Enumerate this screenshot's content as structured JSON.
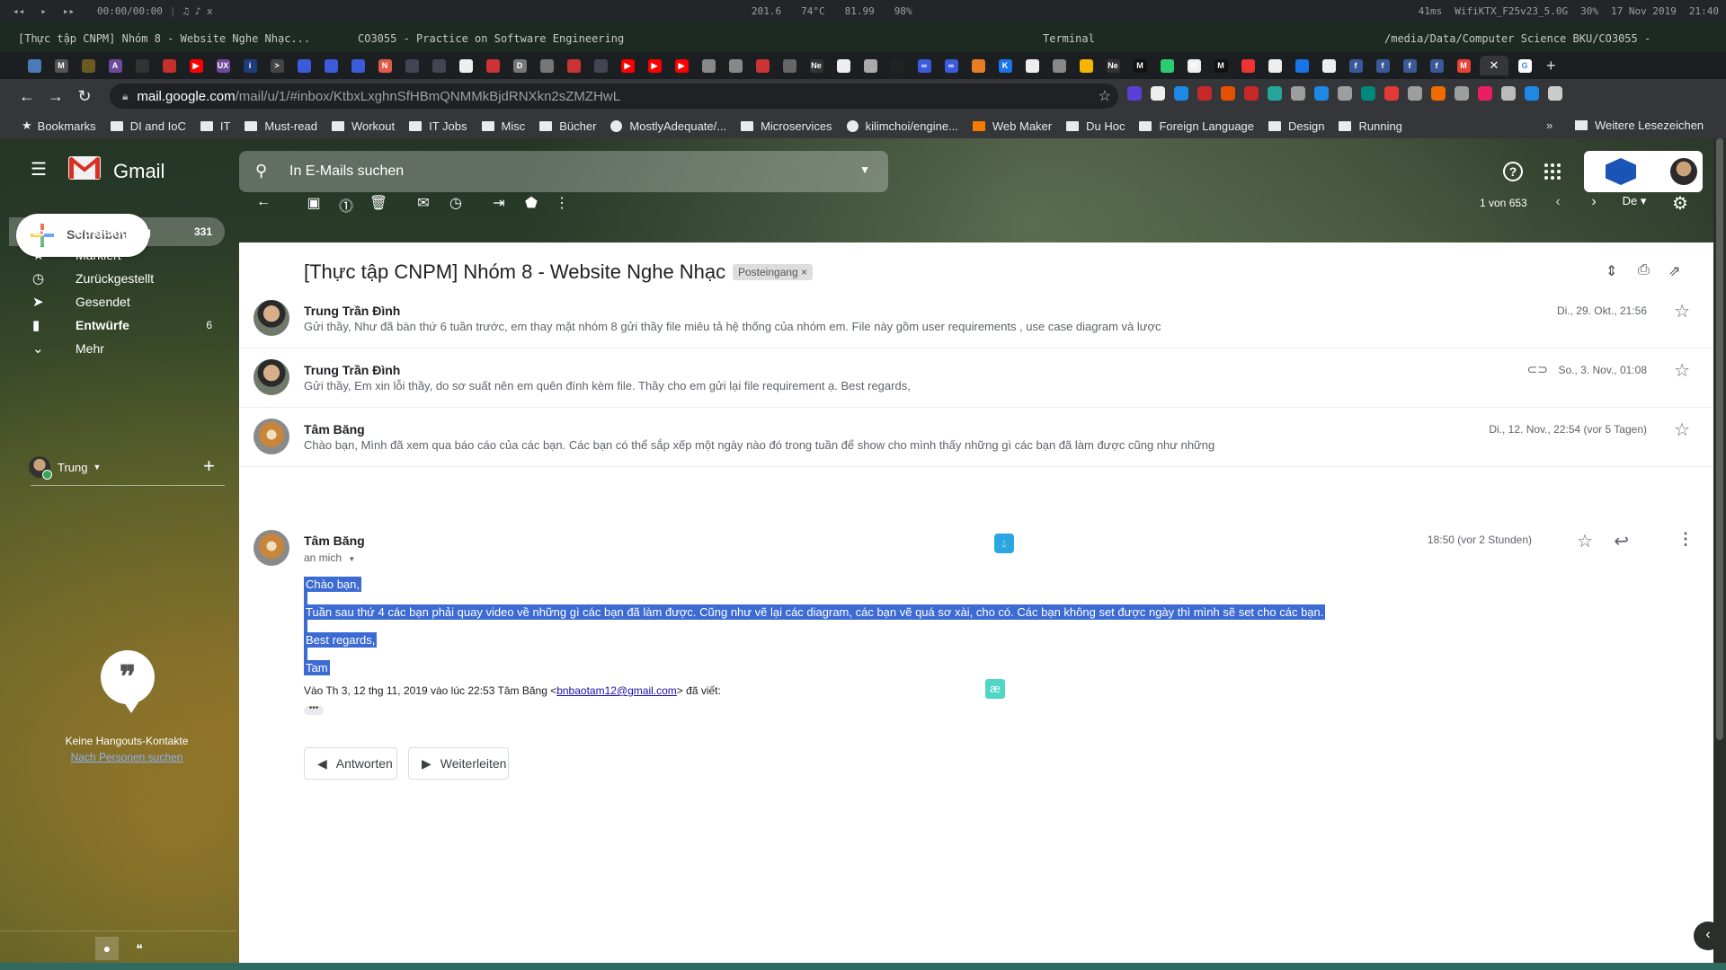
{
  "system_bar": {
    "media_prev": "◂◂",
    "media_play": "▸",
    "media_next": "▸▸",
    "time_display": "00:00/00:00",
    "music_status": "♫ ♪ x",
    "cpu_temp": "74°C",
    "cpu_value": "201.6",
    "mem_value": "81.99",
    "battery": "98%",
    "ping": "41ms",
    "wifi": "WifiKTX_F25v23_5.0G",
    "volume": "30%",
    "date": "17 Nov 2019",
    "clock": "21:40"
  },
  "window_titles": {
    "active": "[Thực tập CNPM] Nhóm 8 - Website Nghe Nhạc...",
    "second": "CO3055 -  Practice on Software Engineering",
    "terminal": "Terminal",
    "path": "/media/Data/Computer Science BKU/CO3055 -"
  },
  "browser": {
    "url_host": "mail.google.com",
    "url_path": "/mail/u/1/#inbox/KtbxLxghnSfHBmQNMMkBjdRNXkn2sZMZHwL",
    "tab_icons": [
      {
        "letter": "",
        "color": "#4a7ab8"
      },
      {
        "letter": "M",
        "color": "#555"
      },
      {
        "letter": "",
        "color": "#6b5a22"
      },
      {
        "letter": "A",
        "color": "#6d4a9b"
      },
      {
        "letter": "",
        "color": "#333"
      },
      {
        "letter": "",
        "color": "#c4302b"
      },
      {
        "letter": "▶",
        "color": "#ff0000"
      },
      {
        "letter": "UX",
        "color": "#6d4a9b"
      },
      {
        "letter": "i",
        "color": "#1f3c7a"
      },
      {
        "letter": ">",
        "color": "#444"
      },
      {
        "letter": "",
        "color": "#3b5bdb"
      },
      {
        "letter": "",
        "color": "#3b5bdb"
      },
      {
        "letter": "",
        "color": "#3b5bdb"
      },
      {
        "letter": "N",
        "color": "#e05a47"
      },
      {
        "letter": "",
        "color": "#445"
      },
      {
        "letter": "",
        "color": "#445"
      },
      {
        "letter": "",
        "color": "#eee"
      },
      {
        "letter": "",
        "color": "#c33"
      },
      {
        "letter": "D",
        "color": "#777"
      },
      {
        "letter": "",
        "color": "#777"
      },
      {
        "letter": "",
        "color": "#c33"
      },
      {
        "letter": "",
        "color": "#445"
      },
      {
        "letter": "▶",
        "color": "#ff0000"
      },
      {
        "letter": "▶",
        "color": "#ff0000"
      },
      {
        "letter": "▶",
        "color": "#ff0000"
      },
      {
        "letter": "",
        "color": "#888"
      },
      {
        "letter": "",
        "color": "#888"
      },
      {
        "letter": "",
        "color": "#c33"
      },
      {
        "letter": "",
        "color": "#666"
      },
      {
        "letter": "Ne",
        "color": "#333"
      },
      {
        "letter": "",
        "color": "#eee"
      },
      {
        "letter": "",
        "color": "#aaa"
      },
      {
        "letter": "",
        "color": "#222"
      },
      {
        "letter": "∞",
        "color": "#3b5bdb"
      },
      {
        "letter": "∞",
        "color": "#3b5bdb"
      },
      {
        "letter": "",
        "color": "#e67e22"
      },
      {
        "letter": "K",
        "color": "#1a73e8"
      },
      {
        "letter": "",
        "color": "#eee"
      },
      {
        "letter": "",
        "color": "#888"
      },
      {
        "letter": "",
        "color": "#f4b400"
      },
      {
        "letter": "Ne",
        "color": "#333"
      },
      {
        "letter": "M",
        "color": "#111"
      },
      {
        "letter": "",
        "color": "#2ecc71"
      },
      {
        "letter": "W",
        "color": "#eee"
      },
      {
        "letter": "M",
        "color": "#111"
      },
      {
        "letter": "",
        "color": "#e33"
      },
      {
        "letter": "",
        "color": "#eee"
      },
      {
        "letter": "",
        "color": "#1a73e8"
      },
      {
        "letter": "",
        "color": "#eee"
      },
      {
        "letter": "f",
        "color": "#3b5998"
      },
      {
        "letter": "f",
        "color": "#3b5998"
      },
      {
        "letter": "f",
        "color": "#3b5998"
      },
      {
        "letter": "f",
        "color": "#3b5998"
      },
      {
        "letter": "M",
        "color": "#ea4335"
      }
    ],
    "active_tab_close": "✕",
    "after_active": {
      "letter": "G",
      "color": "#fff"
    },
    "new_tab": "+",
    "extension_colors": [
      "#5b3fd4",
      "#eee",
      "#1e88e5",
      "#c62828",
      "#e65100",
      "#c62828",
      "#26a69a",
      "#9e9e9e",
      "#1e88e5",
      "#9e9e9e",
      "#00897b",
      "#e53935",
      "#9e9e9e",
      "#ef6c00",
      "#9e9e9e",
      "#e91e63",
      "#bbb",
      "#1e88e5",
      "#ccc"
    ],
    "bookmarks": [
      {
        "label": "Bookmarks",
        "kind": "star"
      },
      {
        "label": "DI and IoC",
        "kind": "folder"
      },
      {
        "label": "IT",
        "kind": "folder"
      },
      {
        "label": "Must-read",
        "kind": "folder"
      },
      {
        "label": "Workout",
        "kind": "folder"
      },
      {
        "label": "IT Jobs",
        "kind": "folder"
      },
      {
        "label": "Misc",
        "kind": "folder"
      },
      {
        "label": "Bücher",
        "kind": "folder"
      },
      {
        "label": "MostlyAdequate/...",
        "kind": "github"
      },
      {
        "label": "Microservices",
        "kind": "folder"
      },
      {
        "label": "kilimchoi/engine...",
        "kind": "github"
      },
      {
        "label": "Web Maker",
        "kind": "webmaker"
      },
      {
        "label": "Du Hoc",
        "kind": "folder"
      },
      {
        "label": "Foreign Language",
        "kind": "folder"
      },
      {
        "label": "Design",
        "kind": "folder"
      },
      {
        "label": "Running",
        "kind": "folder"
      }
    ],
    "bookmarks_more": "»",
    "other_bookmarks": "Weitere Lesezeichen"
  },
  "gmail": {
    "app_name": "Gmail",
    "search_placeholder": "In E-Mails suchen",
    "compose_label": "Schreiben",
    "nav": [
      {
        "label": "Posteingang",
        "count": "331",
        "icon": "▭",
        "active": true,
        "bold": true
      },
      {
        "label": "Markiert",
        "count": "",
        "icon": "★",
        "active": false,
        "bold": false
      },
      {
        "label": "Zurückgestellt",
        "count": "",
        "icon": "◷",
        "active": false,
        "bold": false
      },
      {
        "label": "Gesendet",
        "count": "",
        "icon": "➤",
        "active": false,
        "bold": false
      },
      {
        "label": "Entwürfe",
        "count": "6",
        "icon": "▮",
        "active": false,
        "bold": true
      },
      {
        "label": "Mehr",
        "count": "",
        "icon": "⌄",
        "active": false,
        "bold": false
      }
    ],
    "hangouts_user": "Trung",
    "hangouts_empty": "Keine Hangouts-Kontakte",
    "hangouts_find": "Nach Personen suchen",
    "pager": "1 von 653",
    "thread_subject": "[Thực tập CNPM] Nhóm 8 - Website Nghe Nhạc",
    "thread_label": "Posteingang",
    "label_remove": "×",
    "messages": [
      {
        "sender": "Trung Trần Đình",
        "snippet": "Gửi thầy, Như đã bàn thứ 6 tuần trước, em thay mặt nhóm 8 gửi thầy file miêu tả hệ thống của nhóm em. File này gồm user requirements , use case diagram và lược",
        "date": "Di., 29. Okt., 21:56",
        "avatar": "trung",
        "attachment": false
      },
      {
        "sender": "Trung Trần Đình",
        "snippet": "Gửi thầy, Em xin lỗi thầy, do sơ suất nên em quên đính kèm file. Thầy cho em gửi lại file requirement ạ. Best regards,",
        "date": "So., 3. Nov., 01:08",
        "avatar": "trung",
        "attachment": true
      },
      {
        "sender": "Tâm Băng",
        "snippet": "Chào bạn, Mình đã xem qua báo cáo của các bạn. Các bạn có thể sắp xếp một ngày nào đó trong tuần để show cho mình thấy những gì các bạn đã làm được cũng như những",
        "date": "Di., 12. Nov., 22:54 (vor 5 Tagen)",
        "avatar": "tam",
        "attachment": false
      }
    ],
    "expanded": {
      "sender": "Tâm Băng",
      "to": "an mich",
      "date": "18:50 (vor 2 Stunden)",
      "body": [
        "Chào bạn,",
        "Tuần sau thứ 4 các bạn phải quay video về những gì các bạn đã làm được. Cũng như vẽ lại các diagram, các bạn vẽ quá sơ xài, cho có. Các bạn không set được ngày thì mình sẽ set cho các bạn.",
        "Best regards,",
        "Tam"
      ],
      "quote_prefix": "Vào Th 3, 12 thg 11, 2019 vào lúc 22:53 Tâm Băng <",
      "quote_email": "bnbaotam12@gmail.com",
      "quote_suffix": "> đã viết:",
      "quote_toggle": "•••"
    },
    "reply_label": "Antworten",
    "forward_label": "Weiterleiten"
  }
}
